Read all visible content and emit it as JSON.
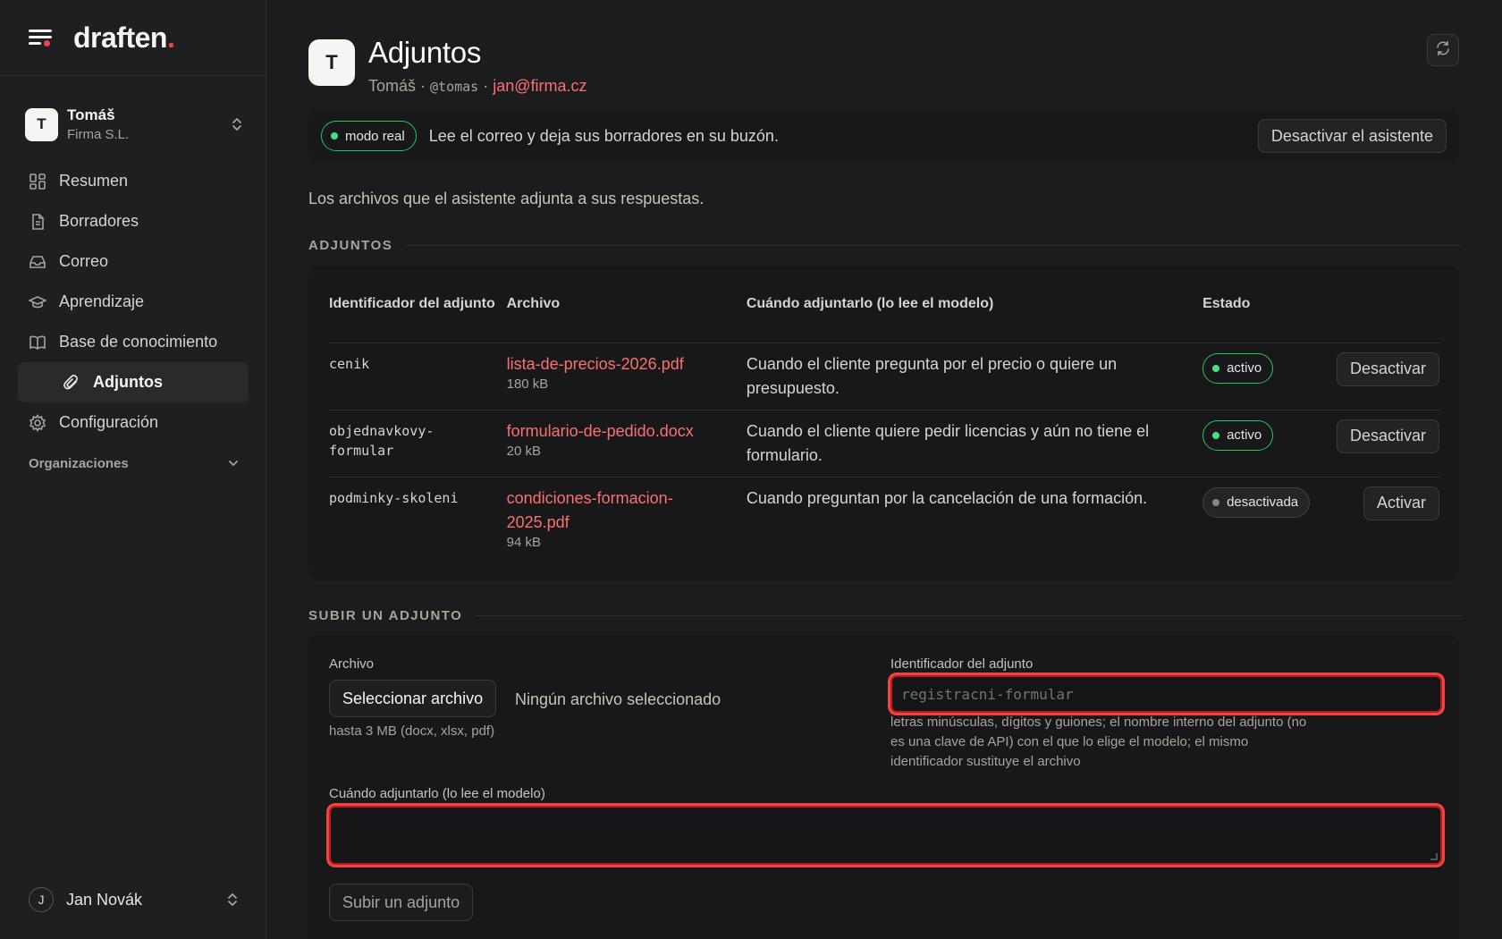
{
  "app": {
    "logo_text": "draften",
    "logo_dot": ".",
    "brand_color": "#ef4444"
  },
  "org": {
    "avatar": "T",
    "name": "Tomáš",
    "subtitle": "Firma S.L."
  },
  "nav": {
    "items": [
      {
        "label": "Resumen",
        "icon": "dashboard-icon"
      },
      {
        "label": "Borradores",
        "icon": "document-icon"
      },
      {
        "label": "Correo",
        "icon": "inbox-icon"
      },
      {
        "label": "Aprendizaje",
        "icon": "graduation-cap-icon"
      },
      {
        "label": "Base de conocimiento",
        "icon": "book-icon"
      },
      {
        "label": "Adjuntos",
        "icon": "paperclip-icon",
        "active": true
      },
      {
        "label": "Configuración",
        "icon": "gear-icon"
      }
    ],
    "organizations_label": "Organizaciones"
  },
  "user": {
    "avatar": "J",
    "name": "Jan Novák"
  },
  "page": {
    "avatar": "T",
    "title": "Adjuntos",
    "meta_name": "Tomáš",
    "meta_sep": " · ",
    "meta_handle": "@tomas",
    "meta_email": "jan@firma.cz",
    "mode_badge": "modo real",
    "mode_text": "Lee el correo y deja sus borradores en su buzón.",
    "disable_assistant": "Desactivar el asistente",
    "intro": "Los archivos que el asistente adjunta a sus respuestas."
  },
  "attachments": {
    "section_label": "ADJUNTOS",
    "columns": {
      "id": "Identificador del adjunto",
      "file": "Archivo",
      "when": "Cuándo adjuntarlo (lo lee el modelo)",
      "state": "Estado"
    },
    "rows": [
      {
        "id_line1": "cenik",
        "id_line2": "",
        "file_line1": "lista-de-precios-2026.pdf",
        "file_line2": "",
        "size": "180 kB",
        "when": "Cuando el cliente pregunta por el precio o quiere un presupuesto.",
        "state": "activo",
        "action": "Desactivar",
        "active": true
      },
      {
        "id_line1": "objednavkovy-",
        "id_line2": "formular",
        "file_line1": "formulario-de-pedido.docx",
        "file_line2": "",
        "size": "20 kB",
        "when": "Cuando el cliente quiere pedir licencias y aún no tiene el formulario.",
        "state": "activo",
        "action": "Desactivar",
        "active": true
      },
      {
        "id_line1": "podminky-skoleni",
        "id_line2": "",
        "file_line1": "condiciones-formacion-",
        "file_line2": "2025.pdf",
        "size": "94 kB",
        "when": "Cuando preguntan por la cancelación de una formación.",
        "state": "desactivada",
        "action": "Activar",
        "active": false
      }
    ]
  },
  "upload": {
    "section_label": "SUBIR UN ADJUNTO",
    "file_label": "Archivo",
    "file_button": "Seleccionar archivo",
    "no_file": "Ningún archivo seleccionado",
    "file_hint": "hasta 3 MB (docx, xlsx, pdf)",
    "id_label": "Identificador del adjunto",
    "id_placeholder": "registracni-formular",
    "id_hint_1": "letras minúsculas, dígitos y guiones; el nombre interno del adjunto (no",
    "id_hint_2": "es una clave de API) con el que lo elige el modelo; el mismo",
    "id_hint_3": "identificador sustituye el archivo",
    "when_label": "Cuándo adjuntarlo (lo lee el modelo)",
    "when_value": "",
    "submit": "Subir un adjunto"
  }
}
